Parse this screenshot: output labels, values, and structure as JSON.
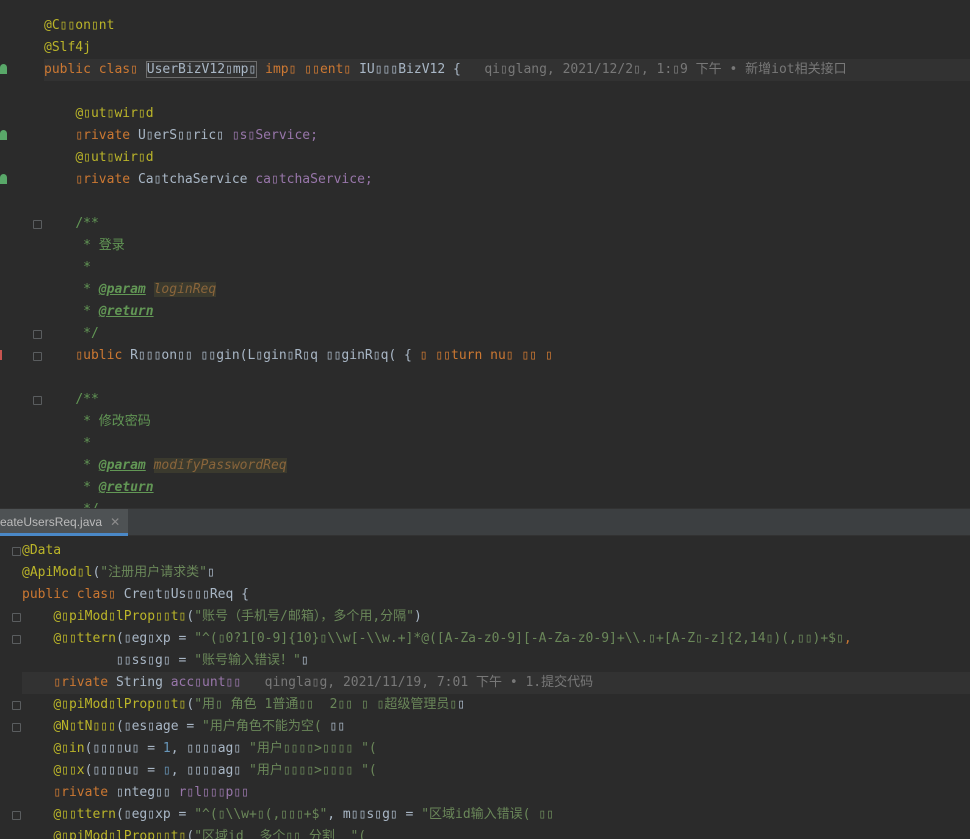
{
  "top_editor": {
    "lines": [
      {
        "t": "@C▯▯on▯nt"
      },
      {
        "t": "@Slf4j"
      },
      {
        "kw": "public clas▯ ",
        "cls": "UserBizV12▯mp▯",
        "rest1": " imp▯ ▯▯ent▯ ",
        "rest2": "IU▯▯▯BizV12 {",
        "blame": "qi▯glang, 2021/12/2▯, 1:▯9 下午 • 新增iot相关接口"
      },
      {
        "t": ""
      },
      {
        "ann": "@▯ut▯wir▯d"
      },
      {
        "kw": "▯rivate ",
        "type": "U▯erS▯▯ric▯ ",
        "field": "▯s▯Service;"
      },
      {
        "ann": "@▯ut▯wir▯d"
      },
      {
        "kw": "▯rivate ",
        "type": "Ca▯tchaService ",
        "field": "ca▯tchaService;"
      },
      {
        "t": ""
      },
      {
        "cmt": "/**"
      },
      {
        "cmt": " * 登录"
      },
      {
        "cmt": " *"
      },
      {
        "cmt": " * ",
        "tag": "@param",
        "param": "loginReq"
      },
      {
        "cmt": " * ",
        "tag": "@return"
      },
      {
        "cmt": " */"
      },
      {
        "kw": "▯ublic ",
        "type": "R▯▯▯on▯▯ ▯▯gin(L▯gin▯R▯q ▯▯ginR▯q( { ",
        "kw2": "▯ ▯▯turn ",
        "rest": "nu▯ ▯▯ ▯"
      },
      {
        "t": ""
      },
      {
        "cmt": "/**"
      },
      {
        "cmt": " * 修改密码"
      },
      {
        "cmt": " *"
      },
      {
        "cmt": " * ",
        "tag": "@param",
        "param": "modifyPasswordReq"
      },
      {
        "cmt": " * ",
        "tag": "@return"
      },
      {
        "cmt": " */"
      }
    ]
  },
  "tab": {
    "label": "eateUsersReq.java",
    "close": "✕"
  },
  "bottom_editor": {
    "lines": [
      {
        "ann": "@Data"
      },
      {
        "ann": "@ApiMod▯l",
        "rest": "(",
        "str": "\"注册用户请求类\"",
        "rest2": "▯"
      },
      {
        "kw": "public clas▯ ",
        "type": "Cre▯t▯Us▯▯▯Req {"
      },
      {
        "ann": "@▯piMod▯lProp▯▯t▯",
        "rest": "(",
        "str": "\"账号（手机号/邮箱），多个用,分隔\"",
        "rest2": ")"
      },
      {
        "ann": "@▯▯ttern",
        "rest": "(▯eg▯xp = ",
        "str": "\"^(▯0?1[0-9]{10}▯\\\\w[-\\\\w.+]*@([A-Za-z0-9][-A-Za-z0-9]+\\\\.▯+[A-Z▯-z]{2,14▯)(,▯▯)+$▯",
        "rest2": ","
      },
      {
        "rest": "        ▯▯ss▯g▯ = ",
        "str": "\"账号输入错误！\"",
        "rest2": "▯"
      },
      {
        "kw": "▯rivate ",
        "type": "String ",
        "field": "acc▯unt▯▯",
        "blame": "qingla▯g, 2021/11/19, 7:01 下午 • 1.提交代码"
      },
      {
        "ann": "@▯piMod▯lProp▯▯t▯",
        "rest": "(",
        "str": "\"用▯ 角色 1普通▯▯  2▯▯ ▯ ▯超级管理员▯",
        "rest2": "▯"
      },
      {
        "ann": "@N▯tN▯▯▯",
        "rest": "(▯es▯age = ",
        "str": "\"用户角色不能为空(",
        "rest2": " ▯▯"
      },
      {
        "ann": "@▯in",
        "rest": "(▯▯▯▯u▯ = ",
        "num": "1",
        "rest2": ", ▯▯▯▯ag▯ ",
        "str": "\"用户▯▯▯▯>▯▯▯▯ \"("
      },
      {
        "ann": "@▯▯x",
        "rest": "(▯▯▯▯u▯ = ",
        "num": "▯",
        "rest2": ", ▯▯▯▯ag▯ ",
        "str": "\"用户▯▯▯▯>▯▯▯▯ \"("
      },
      {
        "kw": "▯rivate ",
        "type": "▯nteg▯▯ ",
        "field": "r▯l▯▯▯p▯▯"
      },
      {
        "ann": "@▯▯ttern",
        "rest": "(▯eg▯xp = ",
        "str": "\"^(▯\\\\w+▯(,▯▯▯+$\"",
        "rest2": ", m▯▯s▯g▯ = ",
        "str2": "\"区域id输入错误( ▯▯"
      },
      {
        "ann": "@▯piMod▯lProp▯▯t▯",
        "rest": "(",
        "str": "\"区域id  多个▯▯ 分割  \"("
      }
    ]
  },
  "colors": {
    "bg": "#2b2b2b",
    "keyword": "#cc7832",
    "annotation": "#bbb529",
    "string": "#6a8759",
    "field": "#9876aa",
    "comment": "#629755"
  }
}
